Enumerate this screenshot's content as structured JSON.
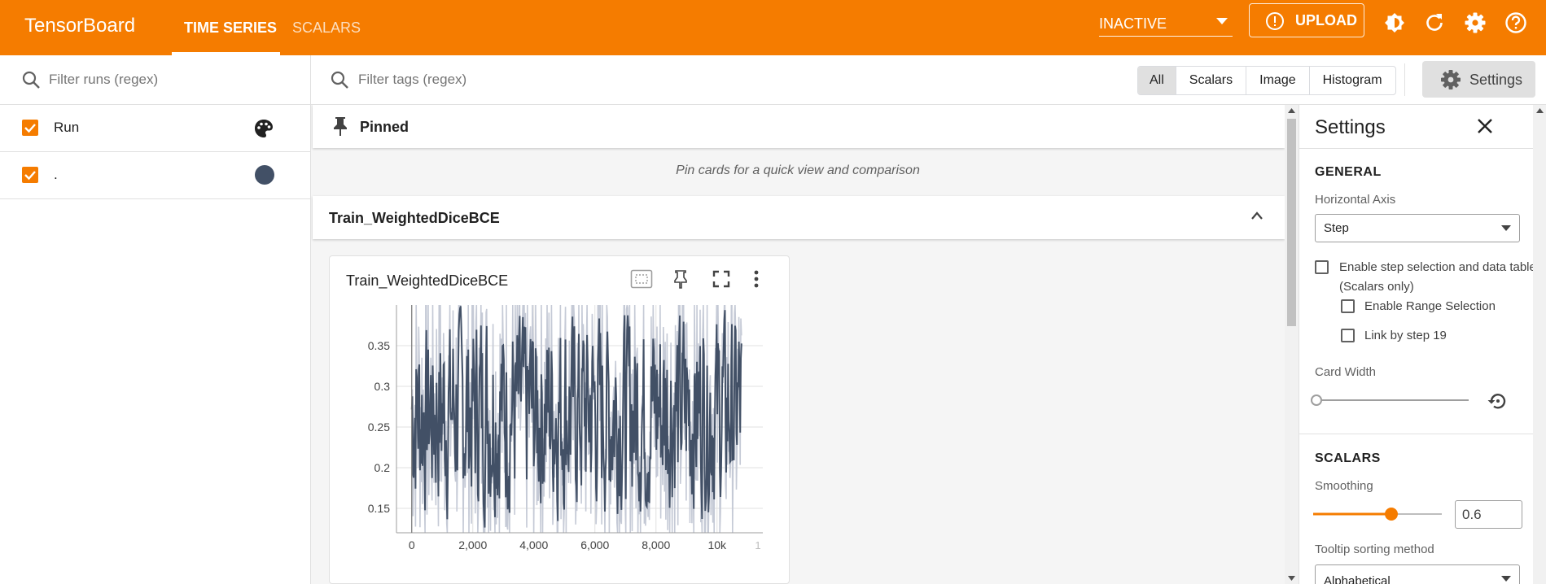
{
  "app": {
    "title": "TensorBoard"
  },
  "nav": {
    "tabs": [
      {
        "label": "TIME SERIES",
        "active": true
      },
      {
        "label": "SCALARS",
        "active": false
      }
    ]
  },
  "header": {
    "reload_mode": "INACTIVE",
    "upload_label": "UPLOAD",
    "icons": [
      "info-icon",
      "theme-icon",
      "reload-icon",
      "settings-icon",
      "help-icon"
    ]
  },
  "runs": {
    "filter_placeholder": "Filter runs (regex)",
    "items": [
      {
        "label": "Run",
        "checked": true,
        "icon": "palette-icon"
      },
      {
        "label": ".",
        "checked": true,
        "color": "#425066"
      }
    ]
  },
  "main": {
    "filter_placeholder": "Filter tags (regex)",
    "type_filters": [
      {
        "label": "All",
        "active": true
      },
      {
        "label": "Scalars",
        "active": false
      },
      {
        "label": "Image",
        "active": false
      },
      {
        "label": "Histogram",
        "active": false
      }
    ],
    "settings_button": "Settings",
    "pinned_title": "Pinned",
    "pinned_empty": "Pin cards for a quick view and comparison",
    "group_title": "Train_WeightedDiceBCE"
  },
  "card": {
    "title": "Train_WeightedDiceBCE",
    "chart_data": {
      "type": "line",
      "title": "Train_WeightedDiceBCE",
      "xlim": [
        -500,
        11500
      ],
      "ylim": [
        0.12,
        0.4
      ],
      "x_ticks": [
        "0",
        "2,000",
        "4,000",
        "6,000",
        "8,000",
        "10k",
        "1"
      ],
      "y_ticks": [
        "0.15",
        "0.2",
        "0.25",
        "0.3",
        "0.35"
      ],
      "x_tick_values": [
        0,
        2000,
        4000,
        6000,
        8000,
        10000
      ],
      "y_tick_values": [
        0.15,
        0.2,
        0.25,
        0.3,
        0.35
      ],
      "series": [
        {
          "smoothing": 0.6,
          "color": "#425066",
          "raw_color": "#c5cad6",
          "x_range": [
            0,
            10800
          ],
          "y_range": [
            0.12,
            0.4
          ],
          "points": 520
        }
      ],
      "grid": true
    }
  },
  "settings": {
    "title": "Settings",
    "general_heading": "GENERAL",
    "horizontal_axis_label": "Horizontal Axis",
    "horizontal_axis_value": "Step",
    "step_selection_label": "Enable step selection and data table",
    "step_selection_sub": "(Scalars only)",
    "range_selection_label": "Enable Range Selection",
    "link_step_label": "Link by step 19",
    "card_width_label": "Card Width",
    "scalars_heading": "SCALARS",
    "smoothing_label": "Smoothing",
    "smoothing_value": "0.6",
    "tooltip_sort_label": "Tooltip sorting method",
    "tooltip_sort_value": "Alphabetical"
  }
}
